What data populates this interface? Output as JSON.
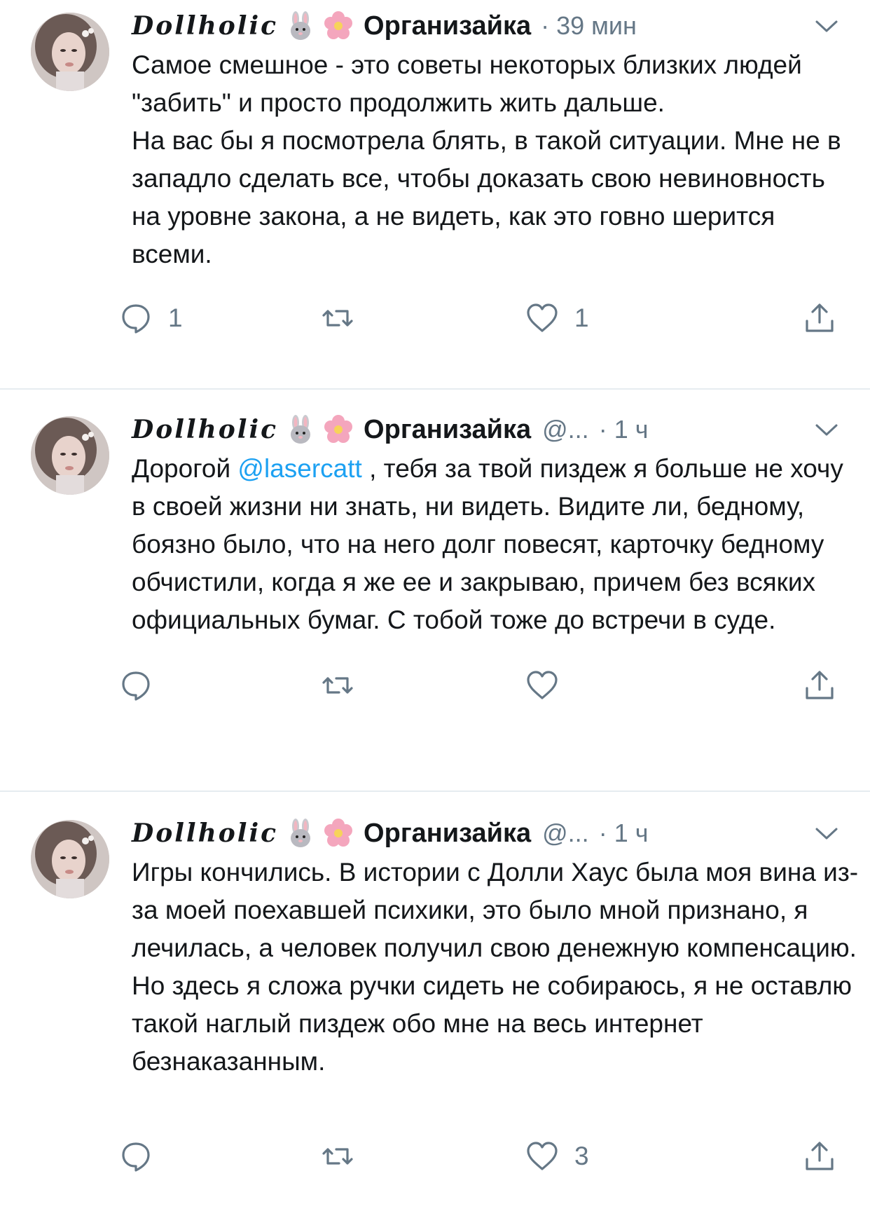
{
  "tweets": [
    {
      "display_name_script": "Dollholic",
      "display_name": "Организайка",
      "handle": "",
      "separator": "·",
      "time": "39 мин",
      "text": "Самое смешное - это советы некоторых близких людей \"забить\" и просто продолжить жить дальше.\nНа вас бы я посмотрела блять, в такой ситуации. Мне не в западло сделать все, чтобы доказать свою невиновность на уровне закона, а не видеть, как это говно шерится всеми.",
      "replies": "1",
      "retweets": "",
      "likes": "1"
    },
    {
      "display_name_script": "Dollholic",
      "display_name": "Организайка",
      "handle": "@...",
      "separator": "·",
      "time": "1 ч",
      "text_before": "Дорогой ",
      "mention": "@lasercatt",
      "text_after": " , тебя за твой пиздеж я больше не хочу в своей жизни ни знать, ни видеть. Видите ли, бедному, боязно было, что на него долг повесят,  карточку бедному обчистили, когда я же ее и закрываю, причем без всяких официальных бумаг. С тобой тоже до встречи в суде.",
      "replies": "",
      "retweets": "",
      "likes": ""
    },
    {
      "display_name_script": "Dollholic",
      "display_name": "Организайка",
      "handle": "@...",
      "separator": "·",
      "time": "1 ч",
      "text": "Игры кончились. В истории с Долли Хаус была моя вина из-за моей поехавшей психики, это было мной признано, я лечилась, а человек получил свою денежную компенсацию.\nНо здесь я сложа ручки сидеть не собираюсь, я не оставлю такой наглый пиздеж обо мне на весь интернет безнаказанным.",
      "replies": "",
      "retweets": "",
      "likes": "3"
    }
  ],
  "icons": {
    "reply": "reply-icon",
    "retweet": "retweet-icon",
    "like": "heart-icon",
    "share": "share-icon",
    "menu": "chevron-down-icon",
    "emoji1": "rabbit-emoji-icon",
    "emoji2": "cherry-blossom-emoji-icon"
  },
  "colors": {
    "text": "#14171a",
    "secondary": "#657786",
    "mention": "#1da1f2",
    "divider": "#e6ecf0"
  }
}
